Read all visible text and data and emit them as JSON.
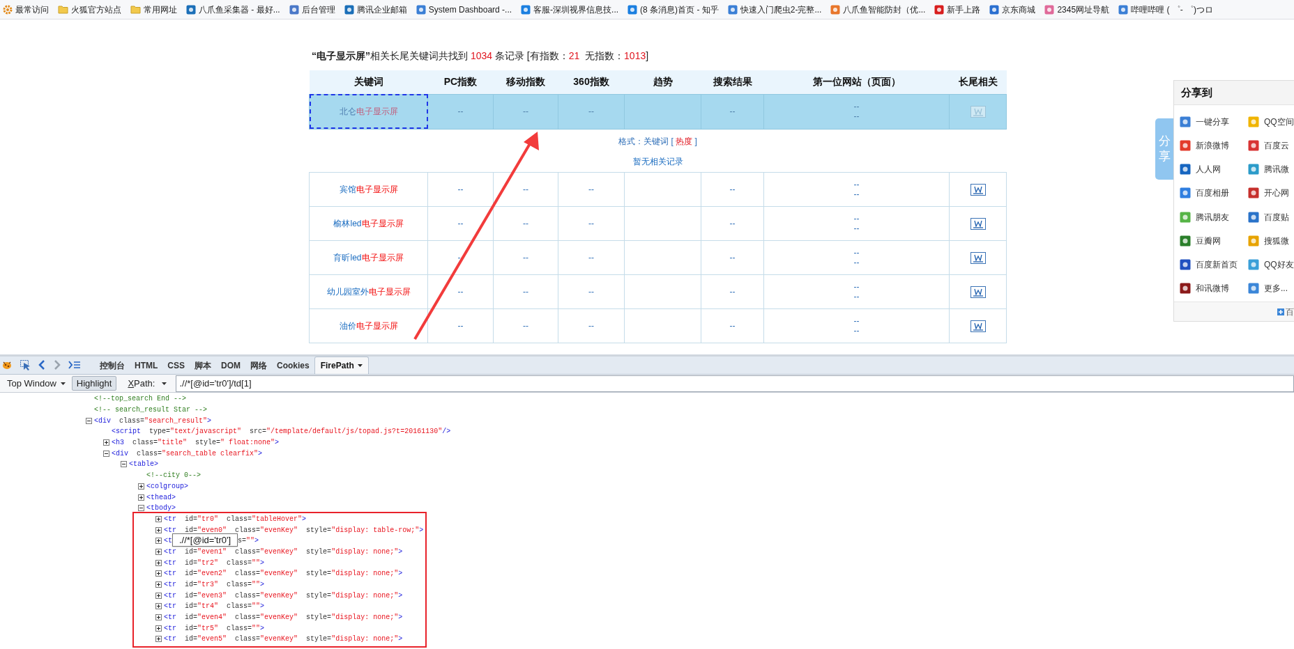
{
  "bookmarks": [
    {
      "label": "最常访问",
      "kind": "gear"
    },
    {
      "label": "火狐官方站点",
      "kind": "folder"
    },
    {
      "label": "常用网址",
      "kind": "folder"
    },
    {
      "label": "八爪鱼采集器 - 最好...",
      "kind": "site"
    },
    {
      "label": "后台管理",
      "kind": "site"
    },
    {
      "label": "腾讯企业邮箱",
      "kind": "site"
    },
    {
      "label": "System Dashboard -...",
      "kind": "site"
    },
    {
      "label": "客服-深圳视界信息技...",
      "kind": "site"
    },
    {
      "label": "(8 条消息)首页 - 知乎",
      "kind": "site"
    },
    {
      "label": "快速入门爬虫2-完整...",
      "kind": "site"
    },
    {
      "label": "八爪鱼智能防封（优...",
      "kind": "site"
    },
    {
      "label": "新手上路",
      "kind": "site"
    },
    {
      "label": "京东商城",
      "kind": "site"
    },
    {
      "label": "2345网址导航",
      "kind": "site"
    },
    {
      "label": "哔哩哔哩 ( ゜- ゜)つロ",
      "kind": "site"
    }
  ],
  "summary": [
    {
      "text": "“电子显示屏”",
      "kind": "bold"
    },
    {
      "text": "相关长尾关键词共找到 ",
      "kind": "plain"
    },
    {
      "text": "1034",
      "kind": "count"
    },
    {
      "text": " 条记录 [有指数：",
      "kind": "plain"
    },
    {
      "text": "21",
      "kind": "count"
    },
    {
      "text": "  无指数：",
      "kind": "plain"
    },
    {
      "text": "1013",
      "kind": "count"
    },
    {
      "text": "]",
      "kind": "plain"
    }
  ],
  "table": {
    "columns": [
      "关键词",
      "PC指数",
      "移动指数",
      "360指数",
      "趋势",
      "搜索结果",
      "第一位网站（页面）",
      "长尾相关"
    ],
    "rows": [
      {
        "selected": true,
        "keyword": [
          {
            "text": "北仑",
            "hit": false
          },
          {
            "text": "电子显示屏",
            "hit": true
          }
        ],
        "pc": "--",
        "mobile": "--",
        "index_360": "--",
        "results": "--",
        "first_site": [
          "--",
          "--"
        ],
        "detail": {
          "format": [
            {
              "text": "格式：关键词 [ ",
              "kind": "plain"
            },
            {
              "text": "热度",
              "kind": "hot"
            },
            {
              "text": " ]",
              "kind": "plain"
            }
          ],
          "empty": "暂无相关记录"
        }
      },
      {
        "selected": false,
        "keyword": [
          {
            "text": "宾馆",
            "hit": false
          },
          {
            "text": "电子显示屏",
            "hit": true
          }
        ],
        "pc": "--",
        "mobile": "--",
        "index_360": "--",
        "results": "--",
        "first_site": [
          "--",
          "--"
        ]
      },
      {
        "selected": false,
        "keyword": [
          {
            "text": "榆林led",
            "hit": false
          },
          {
            "text": "电子显示屏",
            "hit": true
          }
        ],
        "pc": "--",
        "mobile": "--",
        "index_360": "--",
        "results": "--",
        "first_site": [
          "--",
          "--"
        ]
      },
      {
        "selected": false,
        "keyword": [
          {
            "text": "育昕led",
            "hit": false
          },
          {
            "text": "电子显示屏",
            "hit": true
          }
        ],
        "pc": "--",
        "mobile": "--",
        "index_360": "--",
        "results": "--",
        "first_site": [
          "--",
          "--"
        ]
      },
      {
        "selected": false,
        "keyword": [
          {
            "text": "幼儿园室外",
            "hit": false
          },
          {
            "text": "电子显示屏",
            "hit": true
          }
        ],
        "pc": "--",
        "mobile": "--",
        "index_360": "--",
        "results": "--",
        "first_site": [
          "--",
          "--"
        ]
      },
      {
        "selected": false,
        "keyword": [
          {
            "text": "油价",
            "hit": false
          },
          {
            "text": "电子显示屏",
            "hit": true
          }
        ],
        "pc": "--",
        "mobile": "--",
        "index_360": "--",
        "results": "--",
        "first_site": [
          "--",
          "--"
        ]
      }
    ]
  },
  "share": {
    "tab": "分享",
    "title": "分享到",
    "items": [
      "一键分享",
      "QQ空间",
      "新浪微博",
      "百度云",
      "人人网",
      "腾讯微",
      "百度相册",
      "开心网",
      "腾讯朋友",
      "百度贴",
      "豆瓣网",
      "搜狐微",
      "百度新首页",
      "QQ好友",
      "和讯微博",
      "更多..."
    ],
    "footer": "百"
  },
  "devtools": {
    "tabs": [
      {
        "label": "控制台",
        "selected": false
      },
      {
        "label": "HTML",
        "selected": false
      },
      {
        "label": "CSS",
        "selected": false
      },
      {
        "label": "脚本",
        "selected": false
      },
      {
        "label": "DOM",
        "selected": false
      },
      {
        "label": "网络",
        "selected": false
      },
      {
        "label": "Cookies",
        "selected": false
      },
      {
        "label": "FirePath",
        "selected": true
      }
    ],
    "frame": "Top Window",
    "highlight": {
      "label": "Highlight",
      "on": true
    },
    "xpath_label": "XPath:",
    "xpath": ".//*[@id='tr0']/td[1]",
    "tree": [
      {
        "kind": "comment",
        "text": "<!--top_search End -->"
      },
      {
        "kind": "comment",
        "text": "<!-- search_result Star -->"
      },
      {
        "kind": "node",
        "text": "<div  class=\"search_result\">",
        "expanded": true,
        "children": [
          {
            "kind": "leaf",
            "text": "<script  type=\"text/javascript\"  src=\"/template/default/js/topad.js?t=20161130\"/>"
          },
          {
            "kind": "node",
            "text": "<h3  class=\"title\"  style=\" float:none\">",
            "expanded": false
          },
          {
            "kind": "node",
            "text": "<div  class=\"search_table clearfix\">",
            "expanded": true,
            "children": [
              {
                "kind": "node",
                "text": "<table>",
                "expanded": true,
                "children": [
                  {
                    "kind": "comment",
                    "text": "<!--city 0-->"
                  },
                  {
                    "kind": "node",
                    "text": "<colgroup>",
                    "expanded": false
                  },
                  {
                    "kind": "node",
                    "text": "<thead>",
                    "expanded": false
                  },
                  {
                    "kind": "node",
                    "text": "<tbody>",
                    "expanded": true,
                    "boxed": true,
                    "children": [
                      {
                        "kind": "node",
                        "text": "<tr  id=\"tr0\"  class=\"tableHover\">",
                        "expanded": false
                      },
                      {
                        "kind": "node",
                        "text": "<tr  id=\"even0\"  class=\"evenKey\"  style=\"display: table-row;\">",
                        "expanded": false
                      },
                      {
                        "kind": "covered",
                        "head": "<t",
                        "tail": "s=\"\">",
                        "tooltip": ".//*[@id='tr0']",
                        "expanded": false
                      },
                      {
                        "kind": "node",
                        "text": "<tr  id=\"even1\"  class=\"evenKey\"  style=\"display: none;\">",
                        "expanded": false
                      },
                      {
                        "kind": "node",
                        "text": "<tr  id=\"tr2\"  class=\"\">",
                        "expanded": false
                      },
                      {
                        "kind": "node",
                        "text": "<tr  id=\"even2\"  class=\"evenKey\"  style=\"display: none;\">",
                        "expanded": false
                      },
                      {
                        "kind": "node",
                        "text": "<tr  id=\"tr3\"  class=\"\">",
                        "expanded": false
                      },
                      {
                        "kind": "node",
                        "text": "<tr  id=\"even3\"  class=\"evenKey\"  style=\"display: none;\">",
                        "expanded": false
                      },
                      {
                        "kind": "node",
                        "text": "<tr  id=\"tr4\"  class=\"\">",
                        "expanded": false
                      },
                      {
                        "kind": "node",
                        "text": "<tr  id=\"even4\"  class=\"evenKey\"  style=\"display: none;\">",
                        "expanded": false
                      },
                      {
                        "kind": "node",
                        "text": "<tr  id=\"tr5\"  class=\"\">",
                        "expanded": false
                      },
                      {
                        "kind": "node",
                        "text": "<tr  id=\"even5\"  class=\"evenKey\"  style=\"display: none;\">",
                        "expanded": false
                      }
                    ]
                  }
                ]
              }
            ]
          }
        ]
      }
    ]
  }
}
